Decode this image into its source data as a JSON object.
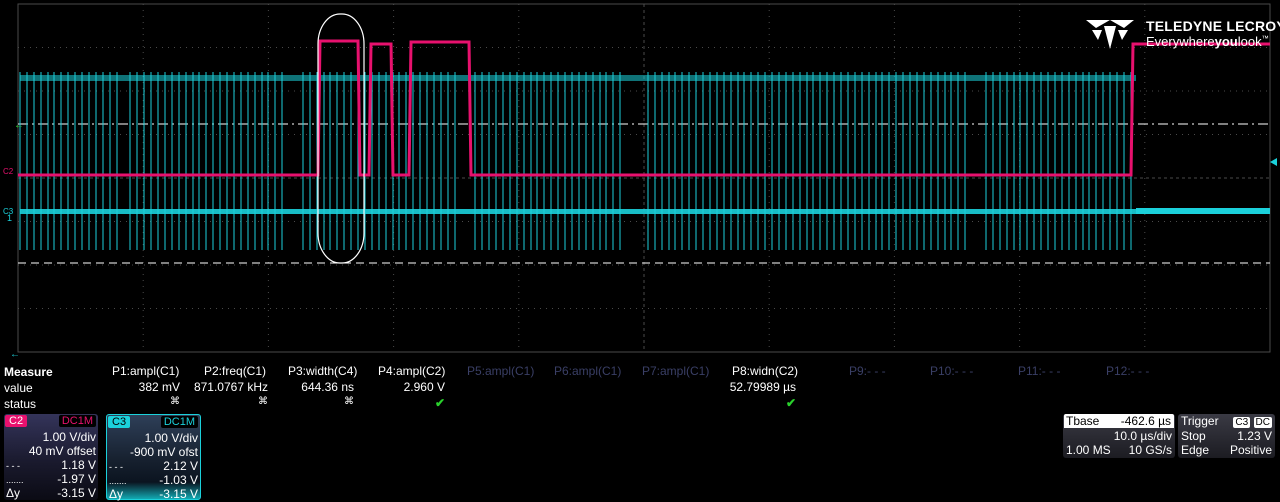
{
  "colors": {
    "c2": "#e8116e",
    "c3": "#1bd1db",
    "grid": "#4a4a4a",
    "dim_text": "#3a3f66",
    "ok": "#29d12c"
  },
  "brand": {
    "name": "TELEDYNE LECROY",
    "tagline_prefix": "Everywhere",
    "tagline_bold": "you",
    "tagline_suffix": "look",
    "tagline_mark": "™"
  },
  "display": {
    "grid_divisions": {
      "x": 10,
      "y": 8
    },
    "c2_marker": "C2",
    "c3_marker": "C3",
    "c3_level": "1"
  },
  "measure": {
    "header": "Measure",
    "row_value": "value",
    "row_status": "status",
    "params": [
      {
        "label": "P1:ampl(C1)",
        "value": "382 mV",
        "status": "invalid-icon",
        "active": true
      },
      {
        "label": "P2:freq(C1)",
        "value": "871.0767 kHz",
        "status": "invalid-icon",
        "active": true
      },
      {
        "label": "P3:width(C4)",
        "value": "644.36 ns",
        "status": "invalid-icon",
        "active": true
      },
      {
        "label": "P4:ampl(C2)",
        "value": "2.960 V",
        "status": "check-icon",
        "active": true
      },
      {
        "label": "P5:ampl(C1)",
        "value": "",
        "status": "",
        "active": false
      },
      {
        "label": "P6:ampl(C1)",
        "value": "",
        "status": "",
        "active": false
      },
      {
        "label": "P7:ampl(C1)",
        "value": "",
        "status": "",
        "active": false
      },
      {
        "label": "P8:widn(C2)",
        "value": "52.79989 µs",
        "status": "check-icon",
        "active": true
      },
      {
        "label": "P9:- - -",
        "value": "",
        "status": "",
        "active": false
      },
      {
        "label": "P10:- - -",
        "value": "",
        "status": "",
        "active": false
      },
      {
        "label": "P11:- - -",
        "value": "",
        "status": "",
        "active": false
      },
      {
        "label": "P12:- - -",
        "value": "",
        "status": "",
        "active": false
      }
    ],
    "status_glyphs": {
      "invalid": "⌘",
      "check": "✔"
    }
  },
  "channels": {
    "c2": {
      "name": "C2",
      "coupling": "DC1M",
      "vdiv": "1.00 V/div",
      "offset": "40 mV offset",
      "cur1_sym": "- - -",
      "cur1": "1.18 V",
      "cur2_sym": ".......",
      "cur2": "-1.97 V",
      "delta_sym": "Δy",
      "delta": "-3.15 V"
    },
    "c3": {
      "name": "C3",
      "coupling": "DC1M",
      "vdiv": "1.00 V/div",
      "offset": "-900 mV ofst",
      "cur1_sym": "- - -",
      "cur1": "2.12 V",
      "cur2_sym": ".......",
      "cur2": "-1.03 V",
      "delta_sym": "Δy",
      "delta": "-3.15 V"
    }
  },
  "timebase": {
    "label": "Tbase",
    "delay": "-462.6 µs",
    "tdiv": "10.0 µs/div",
    "memory": "1.00 MS",
    "rate": "10 GS/s"
  },
  "trigger": {
    "label": "Trigger",
    "source": "C3",
    "coupling": "DC",
    "mode": "Stop",
    "level": "1.23 V",
    "type": "Edge",
    "slope": "Positive"
  }
}
